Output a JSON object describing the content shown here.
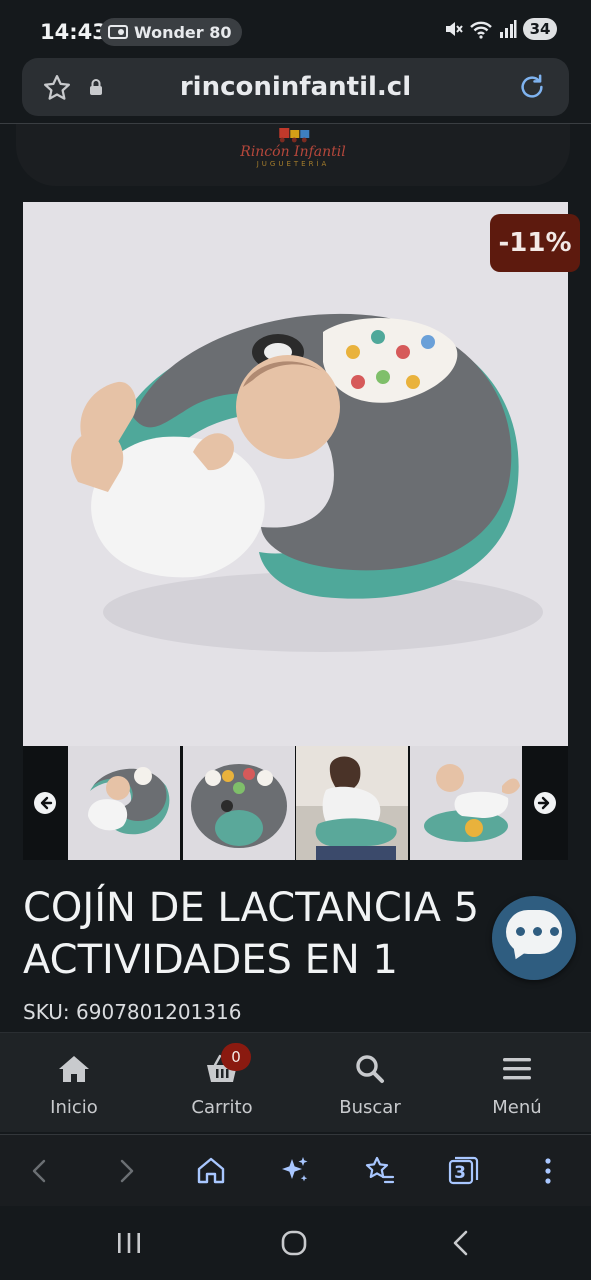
{
  "status_bar": {
    "time": "14:43",
    "notification_label": "Wonder 80",
    "battery": "34",
    "icons": [
      "radio-icon",
      "mute-icon",
      "wifi-icon",
      "signal-icon"
    ]
  },
  "url_bar": {
    "url": "rinconinfantil.cl",
    "icons": [
      "star-icon",
      "lock-icon",
      "reload-icon"
    ]
  },
  "site_header": {
    "logo_name": "Rincón Infantil",
    "logo_subtitle": "JUGUETERÍA"
  },
  "product": {
    "discount": "-11%",
    "title_line1": "COJÍN DE LACTANCIA 5",
    "title_line2": "ACTIVIDADES EN 1",
    "sku_label": "SKU:",
    "sku_value": "6907801201316",
    "thumbnail_count": 4
  },
  "site_nav": {
    "items": [
      {
        "label": "Inicio",
        "icon": "home-icon"
      },
      {
        "label": "Carrito",
        "icon": "cart-icon"
      },
      {
        "label": "Buscar",
        "icon": "search-icon"
      },
      {
        "label": "Menú",
        "icon": "menu-icon"
      }
    ],
    "cart_count": "0"
  },
  "browser_toolbar": {
    "tab_count": "3",
    "buttons": [
      "back-icon",
      "forward-icon",
      "home-icon",
      "ai-sparkle-icon",
      "bookmarks-icon",
      "tabs-icon",
      "more-icon"
    ]
  },
  "colors": {
    "background": "#15191c",
    "discount_badge": "#5d1a0e",
    "chat_button": "#2f5d80",
    "cart_badge": "#8a1a10"
  }
}
